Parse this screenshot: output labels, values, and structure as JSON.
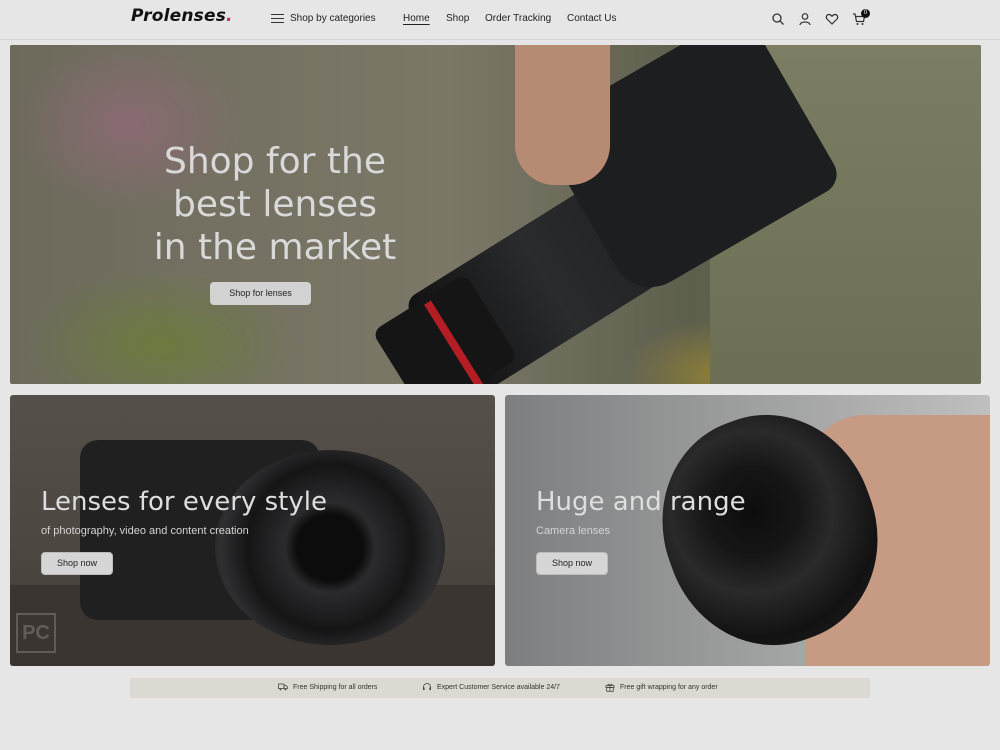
{
  "header": {
    "logo": "Prolenses",
    "logo_dot": ".",
    "categories_label": "Shop by categories",
    "nav": [
      {
        "label": "Home",
        "active": true
      },
      {
        "label": "Shop",
        "active": false
      },
      {
        "label": "Order Tracking",
        "active": false
      },
      {
        "label": "Contact Us",
        "active": false
      }
    ],
    "icons": [
      "search-icon",
      "user-icon",
      "heart-icon",
      "cart-icon"
    ],
    "cart_count": "0"
  },
  "hero": {
    "title_line1": "Shop for the",
    "title_line2": "best lenses",
    "title_line3": "in the market",
    "button": "Shop for lenses"
  },
  "cards": [
    {
      "title": "Lenses for every style",
      "subtitle": "of photography, video and content creation",
      "button": "Shop now"
    },
    {
      "title": "Huge and range",
      "subtitle": "Camera lenses",
      "button": "Shop now"
    }
  ],
  "watermark": "PC",
  "features": [
    {
      "icon": "truck-icon",
      "text": "Free Shipping for all orders"
    },
    {
      "icon": "headset-icon",
      "text": "Expert Customer Service available 24/7"
    },
    {
      "icon": "gift-icon",
      "text": "Free gift wrapping for any order"
    }
  ],
  "colors": {
    "accent": "#d12b55",
    "overlay_bg": "#e6e6e6"
  }
}
